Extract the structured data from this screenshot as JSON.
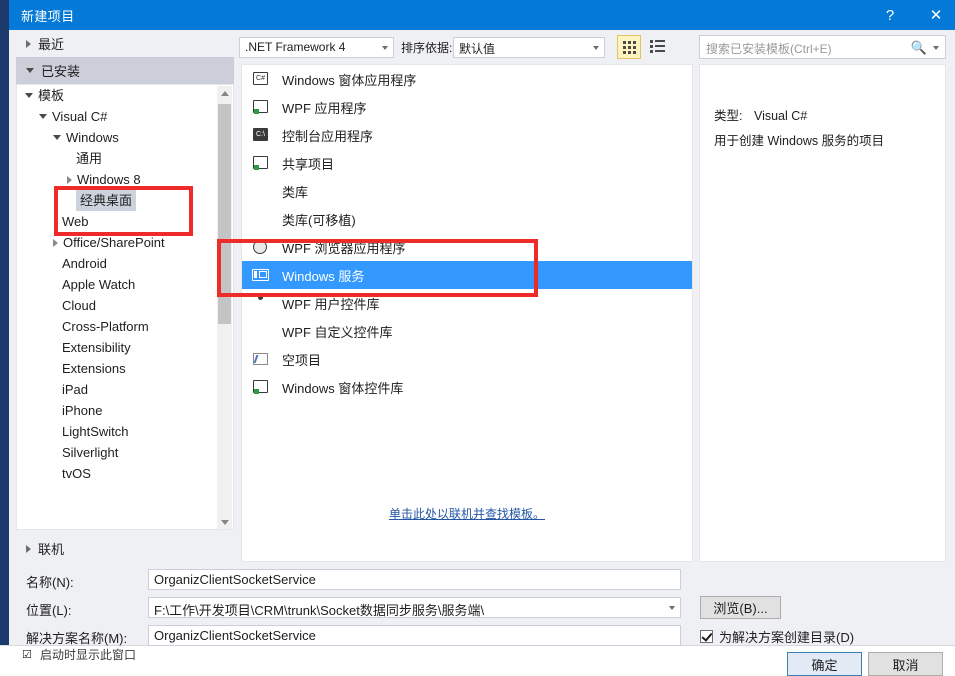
{
  "window": {
    "title": "新建项目",
    "help_label": "?",
    "close_label": "✕"
  },
  "toolbar": {
    "framework": ".NET Framework 4",
    "sort_label": "排序依据:",
    "sort_value": "默认值",
    "view_large_icon": "grid-view-icon",
    "view_list_icon": "list-view-icon",
    "search_placeholder": "搜索已安装模板(Ctrl+E)",
    "search_icon": "search-icon"
  },
  "sidebar": {
    "recent_label": "最近",
    "installed_label": "已安装",
    "online_label": "联机",
    "tree": [
      {
        "label": "模板",
        "indent": 0,
        "marker": "down",
        "selected": false
      },
      {
        "label": "Visual C#",
        "indent": 1,
        "marker": "down",
        "selected": false
      },
      {
        "label": "Windows",
        "indent": 2,
        "marker": "down",
        "selected": false
      },
      {
        "label": "通用",
        "indent": 3,
        "marker": "none",
        "selected": false
      },
      {
        "label": "Windows 8",
        "indent": 3,
        "marker": "right",
        "selected": false
      },
      {
        "label": "经典桌面",
        "indent": 3,
        "marker": "none",
        "selected": true
      },
      {
        "label": "Web",
        "indent": 2,
        "marker": "none",
        "selected": false
      },
      {
        "label": "Office/SharePoint",
        "indent": 2,
        "marker": "right",
        "selected": false
      },
      {
        "label": "Android",
        "indent": 2,
        "marker": "none",
        "selected": false
      },
      {
        "label": "Apple Watch",
        "indent": 2,
        "marker": "none",
        "selected": false
      },
      {
        "label": "Cloud",
        "indent": 2,
        "marker": "none",
        "selected": false
      },
      {
        "label": "Cross-Platform",
        "indent": 2,
        "marker": "none",
        "selected": false
      },
      {
        "label": "Extensibility",
        "indent": 2,
        "marker": "none",
        "selected": false
      },
      {
        "label": "Extensions",
        "indent": 2,
        "marker": "none",
        "selected": false
      },
      {
        "label": "iPad",
        "indent": 2,
        "marker": "none",
        "selected": false
      },
      {
        "label": "iPhone",
        "indent": 2,
        "marker": "none",
        "selected": false
      },
      {
        "label": "LightSwitch",
        "indent": 2,
        "marker": "none",
        "selected": false
      },
      {
        "label": "Silverlight",
        "indent": 2,
        "marker": "none",
        "selected": false
      },
      {
        "label": "tvOS",
        "indent": 2,
        "marker": "none",
        "selected": false
      }
    ]
  },
  "templates": {
    "items": [
      {
        "label": "Windows 窗体应用程序",
        "icon": "csharp-form-icon",
        "selected": false
      },
      {
        "label": "WPF 应用程序",
        "icon": "wpf-app-icon",
        "selected": false
      },
      {
        "label": "控制台应用程序",
        "icon": "console-app-icon",
        "selected": false
      },
      {
        "label": "共享项目",
        "icon": "shared-project-icon",
        "selected": false
      },
      {
        "label": "类库",
        "icon": "class-library-icon",
        "selected": false
      },
      {
        "label": "类库(可移植)",
        "icon": "portable-library-icon",
        "selected": false
      },
      {
        "label": "WPF 浏览器应用程序",
        "icon": "wpf-browser-icon",
        "selected": false
      },
      {
        "label": "Windows 服务",
        "icon": "windows-service-icon",
        "selected": true
      },
      {
        "label": "WPF 用户控件库",
        "icon": "wpf-usercontrol-icon",
        "selected": false
      },
      {
        "label": "WPF 自定义控件库",
        "icon": "wpf-customcontrol-icon",
        "selected": false
      },
      {
        "label": "空项目",
        "icon": "empty-project-icon",
        "selected": false
      },
      {
        "label": "Windows 窗体控件库",
        "icon": "winforms-control-icon",
        "selected": false
      }
    ],
    "online_link": "单击此处以联机并查找模板。"
  },
  "info": {
    "type_label": "类型:",
    "type_value": "Visual C#",
    "description": "用于创建 Windows 服务的项目"
  },
  "form": {
    "name_label": "名称(N):",
    "name_value": "OrganizClientSocketService",
    "location_label": "位置(L):",
    "location_value": "F:\\工作\\开发项目\\CRM\\trunk\\Socket数据同步服务\\服务端\\",
    "solution_label": "解决方案名称(M):",
    "solution_value": "OrganizClientSocketService",
    "browse_label": "浏览(B)...",
    "create_dir_label": "为解决方案创建目录(D)",
    "ok_label": "确定",
    "cancel_label": "取消"
  },
  "backdrop": {
    "text": "启动时显示此窗口"
  },
  "colors": {
    "titlebar": "#0479d7",
    "selection": "#3399ff",
    "annotation": "#ee2b28",
    "link": "#2456a4"
  }
}
